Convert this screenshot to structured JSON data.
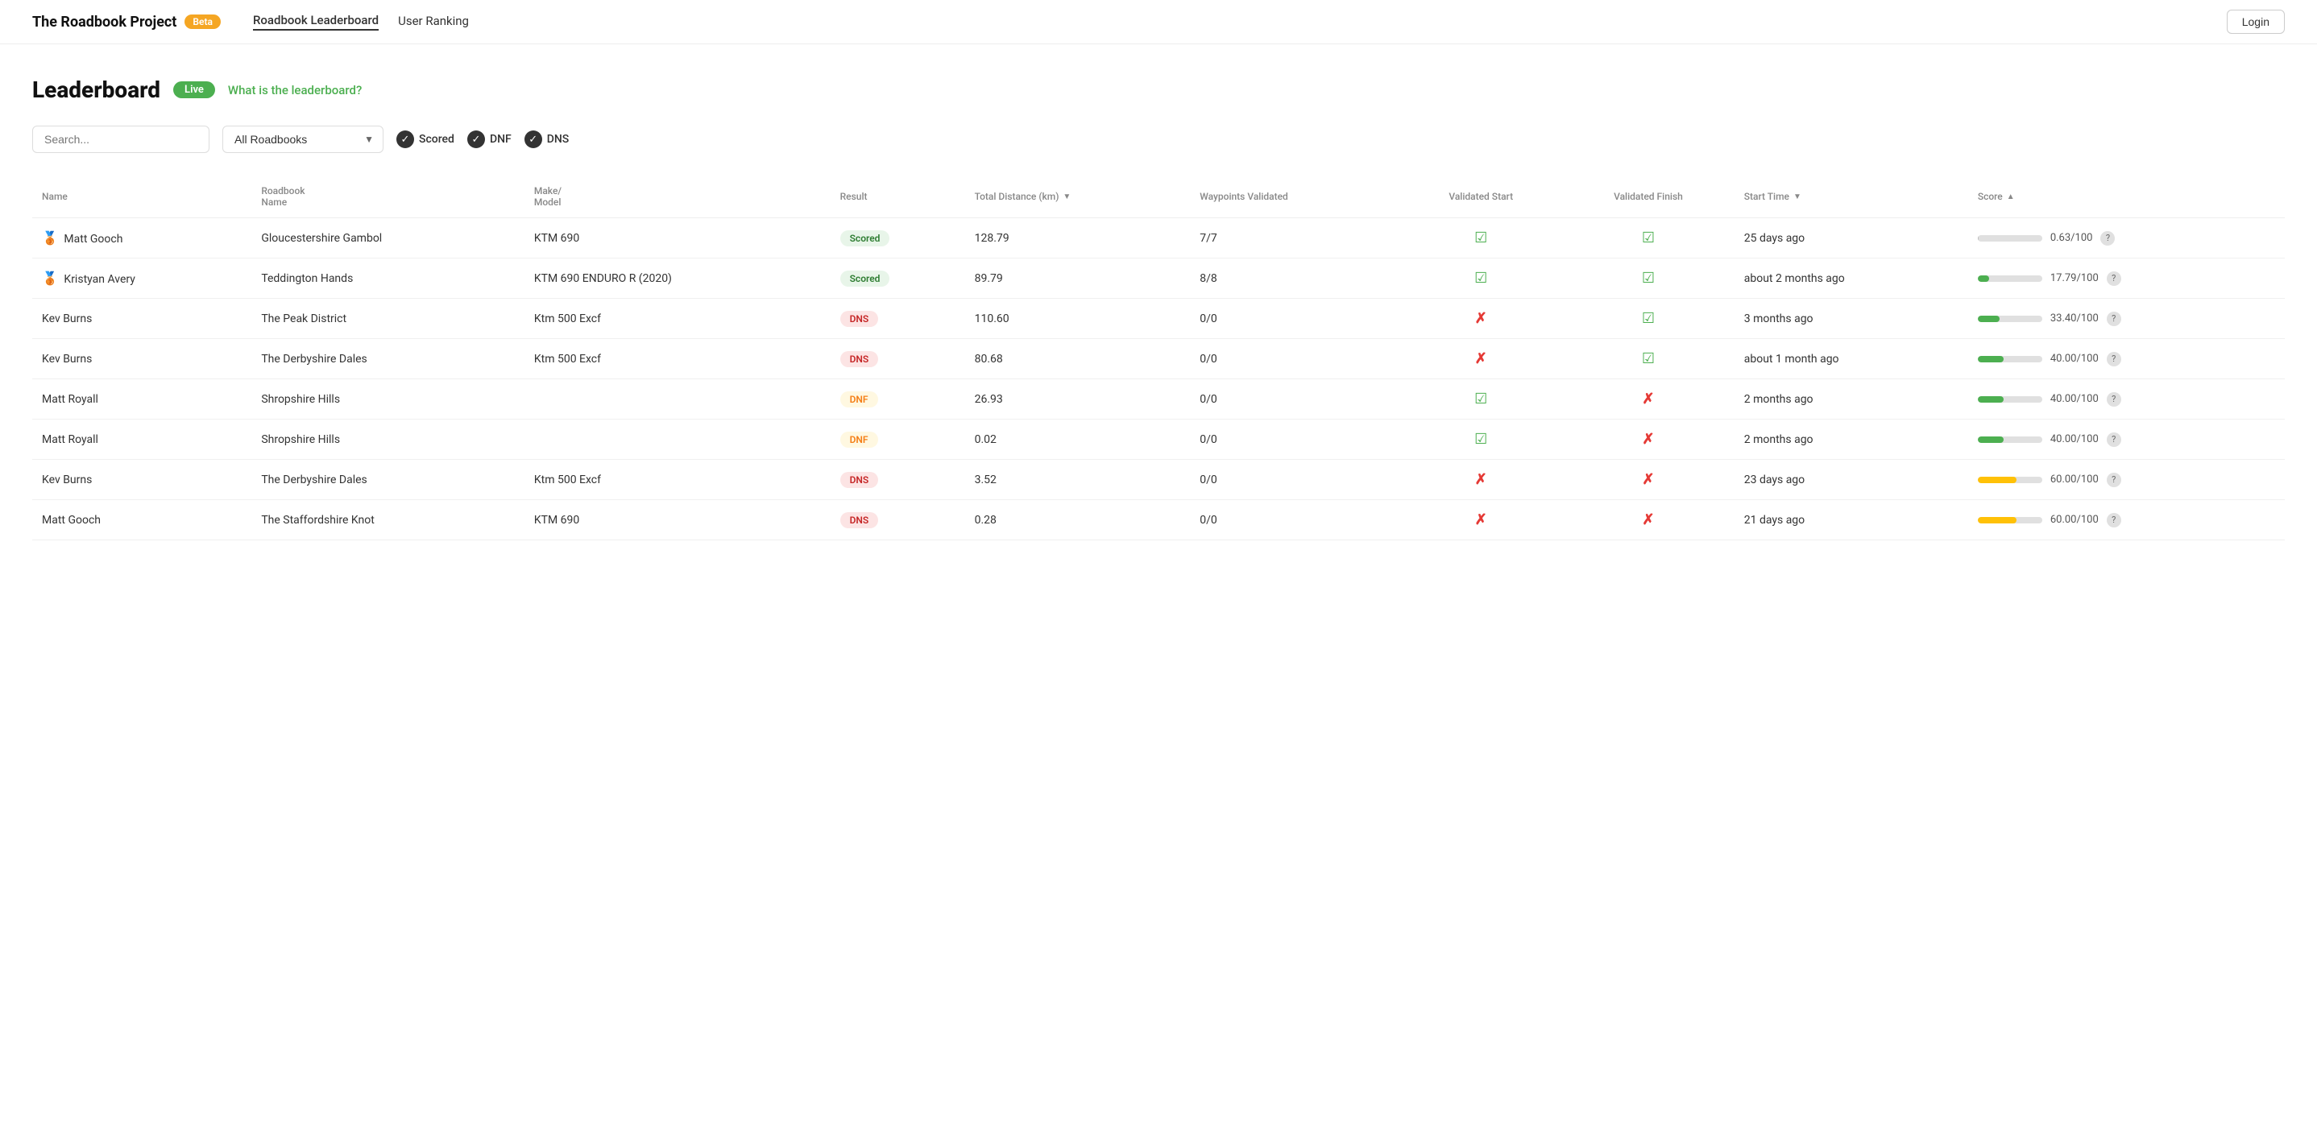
{
  "brand": {
    "title": "The Roadbook Project",
    "beta_label": "Beta"
  },
  "nav": {
    "links": [
      {
        "label": "Roadbook Leaderboard",
        "active": true
      },
      {
        "label": "User Ranking",
        "active": false
      }
    ]
  },
  "header": {
    "login_label": "Login"
  },
  "page": {
    "title": "Leaderboard",
    "live_label": "Live",
    "info_link": "What is the leaderboard?"
  },
  "filters": {
    "search_placeholder": "Search...",
    "roadbook_default": "All Roadbooks",
    "checkboxes": [
      {
        "label": "Scored"
      },
      {
        "label": "DNF"
      },
      {
        "label": "DNS"
      }
    ]
  },
  "table": {
    "columns": [
      {
        "key": "name",
        "label": "Name"
      },
      {
        "key": "roadbook",
        "label": "Roadbook Name"
      },
      {
        "key": "make",
        "label": "Make/ Model"
      },
      {
        "key": "result",
        "label": "Result"
      },
      {
        "key": "distance",
        "label": "Total Distance (km)"
      },
      {
        "key": "waypoints",
        "label": "Waypoints Validated"
      },
      {
        "key": "vstart",
        "label": "Validated Start"
      },
      {
        "key": "vfinish",
        "label": "Validated Finish"
      },
      {
        "key": "starttime",
        "label": "Start Time"
      },
      {
        "key": "score",
        "label": "Score"
      }
    ],
    "rows": [
      {
        "name": "Matt Gooch",
        "medal": "🥉",
        "roadbook": "Gloucestershire Gambol",
        "make": "KTM 690",
        "result": "Scored",
        "result_type": "scored",
        "distance": "128.79",
        "waypoints": "7/7",
        "v_start": true,
        "v_finish": true,
        "start_time": "25 days ago",
        "score_val": 0.63,
        "score_pct": 0.63,
        "score_label": "0.63/100",
        "bar_color": "#bdbdbd"
      },
      {
        "name": "Kristyan Avery",
        "medal": "🥉",
        "roadbook": "Teddington Hands",
        "make": "KTM 690 ENDURO R (2020)",
        "result": "Scored",
        "result_type": "scored",
        "distance": "89.79",
        "waypoints": "8/8",
        "v_start": true,
        "v_finish": true,
        "start_time": "about 2 months ago",
        "score_val": 17.79,
        "score_pct": 17.79,
        "score_label": "17.79/100",
        "bar_color": "#4caf50"
      },
      {
        "name": "Kev Burns",
        "medal": "",
        "roadbook": "The Peak District",
        "make": "Ktm 500 Excf",
        "result": "DNS",
        "result_type": "dns",
        "distance": "110.60",
        "waypoints": "0/0",
        "v_start": false,
        "v_finish": true,
        "start_time": "3 months ago",
        "score_val": 33.4,
        "score_pct": 33.4,
        "score_label": "33.40/100",
        "bar_color": "#4caf50"
      },
      {
        "name": "Kev Burns",
        "medal": "",
        "roadbook": "The Derbyshire Dales",
        "make": "Ktm 500 Excf",
        "result": "DNS",
        "result_type": "dns",
        "distance": "80.68",
        "waypoints": "0/0",
        "v_start": false,
        "v_finish": true,
        "start_time": "about 1 month ago",
        "score_val": 40.0,
        "score_pct": 40.0,
        "score_label": "40.00/100",
        "bar_color": "#4caf50"
      },
      {
        "name": "Matt Royall",
        "medal": "",
        "roadbook": "Shropshire Hills",
        "make": "",
        "result": "DNF",
        "result_type": "dnf",
        "distance": "26.93",
        "waypoints": "0/0",
        "v_start": true,
        "v_finish": false,
        "start_time": "2 months ago",
        "score_val": 40.0,
        "score_pct": 40.0,
        "score_label": "40.00/100",
        "bar_color": "#4caf50"
      },
      {
        "name": "Matt Royall",
        "medal": "",
        "roadbook": "Shropshire Hills",
        "make": "",
        "result": "DNF",
        "result_type": "dnf",
        "distance": "0.02",
        "waypoints": "0/0",
        "v_start": true,
        "v_finish": false,
        "start_time": "2 months ago",
        "score_val": 40.0,
        "score_pct": 40.0,
        "score_label": "40.00/100",
        "bar_color": "#4caf50"
      },
      {
        "name": "Kev Burns",
        "medal": "",
        "roadbook": "The Derbyshire Dales",
        "make": "Ktm 500 Excf",
        "result": "DNS",
        "result_type": "dns",
        "distance": "3.52",
        "waypoints": "0/0",
        "v_start": false,
        "v_finish": false,
        "start_time": "23 days ago",
        "score_val": 60.0,
        "score_pct": 60.0,
        "score_label": "60.00/100",
        "bar_color": "#ffc107"
      },
      {
        "name": "Matt Gooch",
        "medal": "",
        "roadbook": "The Staffordshire Knot",
        "make": "KTM 690",
        "result": "DNS",
        "result_type": "dns",
        "distance": "0.28",
        "waypoints": "0/0",
        "v_start": false,
        "v_finish": false,
        "start_time": "21 days ago",
        "score_val": 60.0,
        "score_pct": 60.0,
        "score_label": "60.00/100",
        "bar_color": "#ffc107"
      }
    ]
  }
}
